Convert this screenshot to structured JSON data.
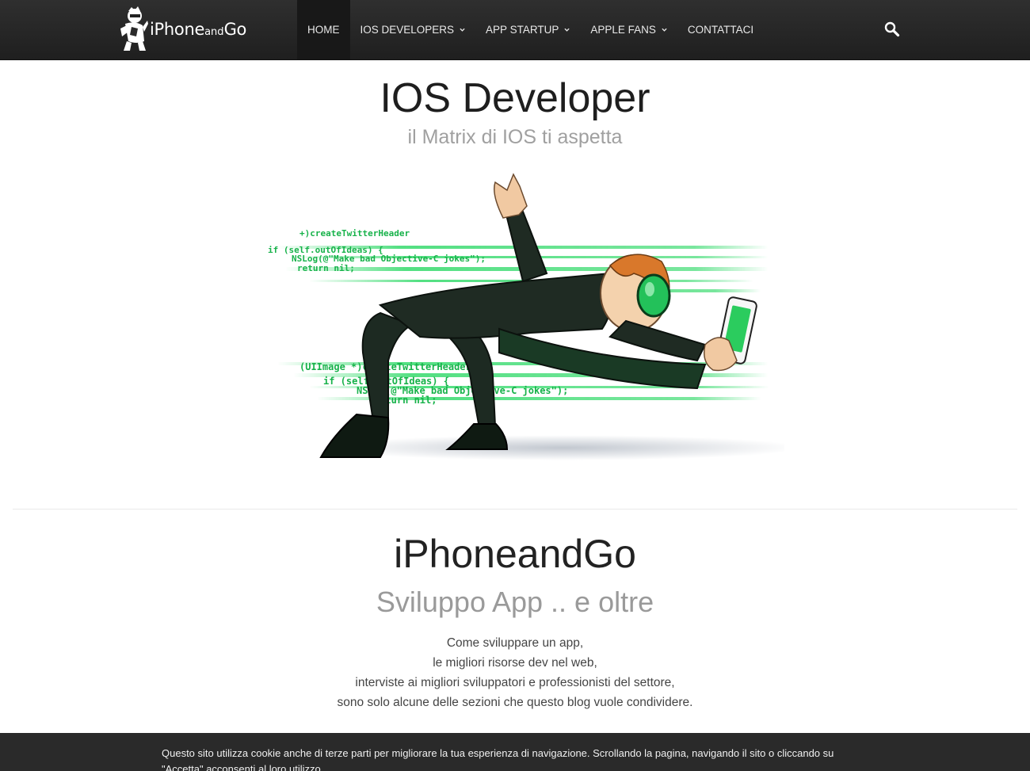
{
  "nav": {
    "logo": {
      "prefix": "iPhone",
      "middle": "and",
      "suffix": "Go"
    },
    "menu": [
      {
        "label": "HOME",
        "has_dropdown": false,
        "active": true
      },
      {
        "label": "IOS DEVELOPERS",
        "has_dropdown": true,
        "active": false
      },
      {
        "label": "APP STARTUP",
        "has_dropdown": true,
        "active": false
      },
      {
        "label": "APPLE FANS",
        "has_dropdown": true,
        "active": false
      },
      {
        "label": "CONTATTACI",
        "has_dropdown": false,
        "active": false
      }
    ],
    "search_icon": "search-icon",
    "background_color": "#262626"
  },
  "hero": {
    "title": "IOS Developer",
    "subtitle": "il Matrix di IOS ti aspetta"
  },
  "about": {
    "title": "iPhoneandGo",
    "subtitle": "Sviluppo App .. e oltre",
    "lines": [
      "Come sviluppare un app,",
      "le migliori risorse dev nel web,",
      "interviste ai migliori sviluppatori e professionisti del settore,",
      "sono solo alcune delle sezioni che questo blog vuole condividere."
    ]
  },
  "cookie_bar": {
    "text": "Questo sito utilizza cookie anche di terze parti per migliorare la tua esperienza di navigazione. Scrollando la pagina, navigando il sito o cliccando su \"Accetta\" acconsenti al loro utilizzo."
  },
  "colors": {
    "accent_green": "#1fd65c",
    "nav_text": "#e8e8e8",
    "subtitle_gray": "#a0a0a0"
  },
  "illustration": {
    "code_lines": [
      "+)createTwitterHeader",
      "if (self.outOfIdeas) {",
      "NSLog(@\"Make bad Objective-C jokes\");",
      "return nil;",
      "(UIImage *)createTwitterHeader",
      "if (self.outOfIdeas) {",
      "NSLog(@\"Make bad Objective-C jokes\");",
      "return nil;"
    ]
  }
}
